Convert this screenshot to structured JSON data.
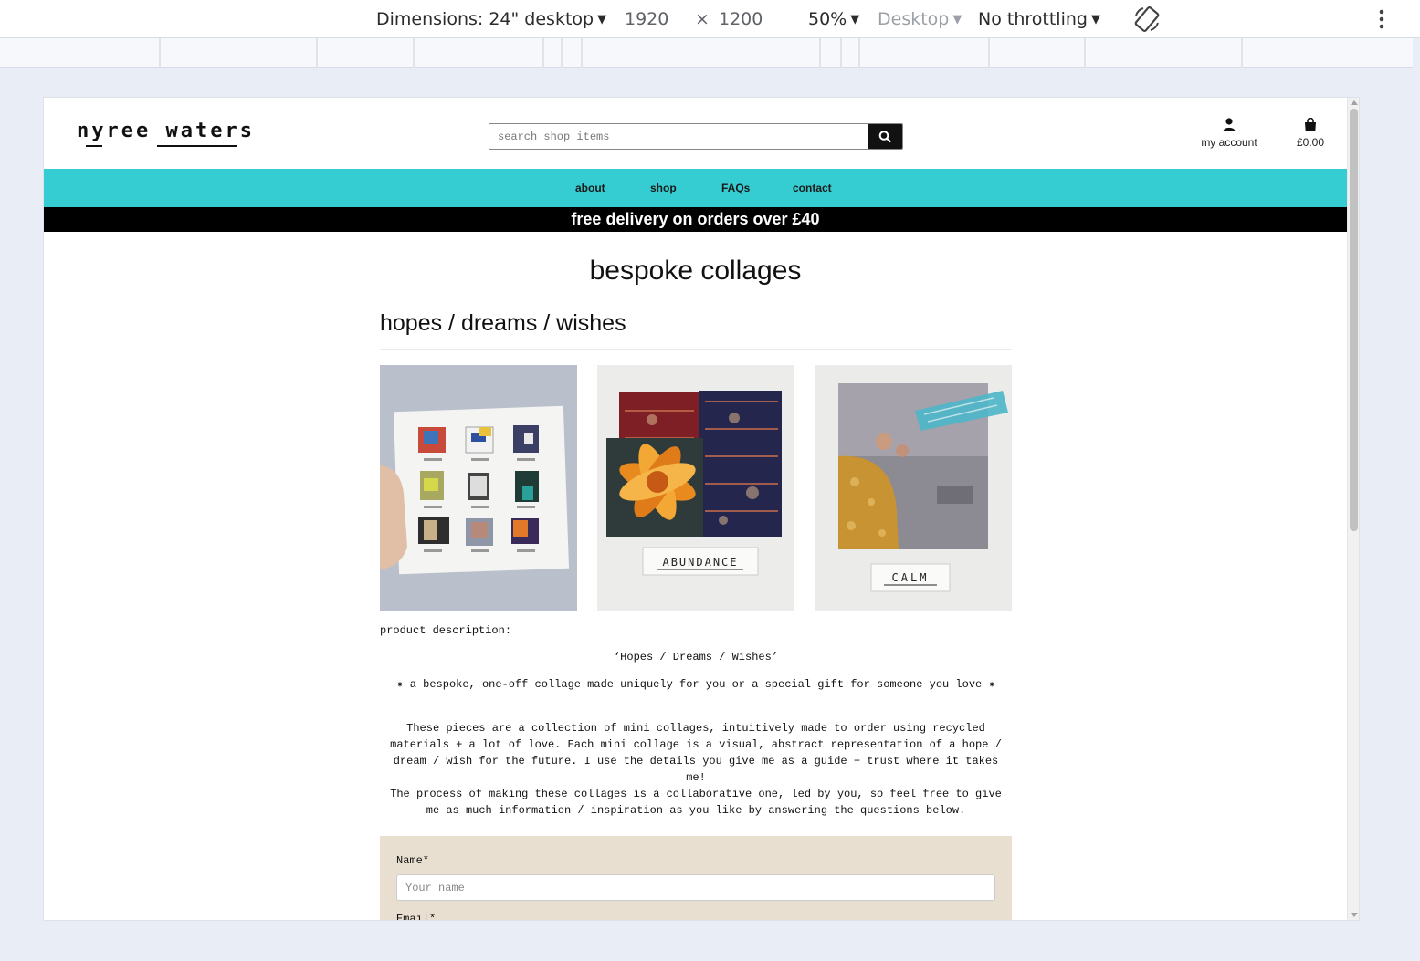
{
  "devtools": {
    "dimensions_label": "Dimensions: 24\" desktop",
    "width": "1920",
    "times": "×",
    "height": "1200",
    "zoom": "50%",
    "device_type": "Desktop",
    "throttling": "No throttling"
  },
  "site": {
    "logo_text": "nyree waters",
    "search_placeholder": "search shop items",
    "account_label": "my account",
    "cart_total": "£0.00",
    "nav": [
      "about",
      "shop",
      "FAQs",
      "contact"
    ],
    "promo": "free delivery on orders over £40",
    "brand_color": "#35cdd1"
  },
  "page": {
    "title": "bespoke collages",
    "product_title": "hopes / dreams / wishes",
    "images": [
      {
        "name": "mini-collage-grid"
      },
      {
        "name": "abundance-collage",
        "label": "ABUNDANCE"
      },
      {
        "name": "calm-collage",
        "label": "CALM"
      }
    ],
    "description_label": "product description:",
    "quote_title": "‘Hopes / Dreams / Wishes’",
    "tagline": "✷ a bespoke, one-off collage made uniquely for you or a special gift for someone you love ✷",
    "paragraph_lines": [
      "These pieces are a collection of mini collages, intuitively made to order using recycled",
      "materials + a lot of love. Each mini collage is a visual, abstract representation of a hope /",
      "dream / wish for the future. I use the details you give me as a guide + trust where it takes",
      "me!",
      "The process of making these collages is a collaborative one, led by you, so feel free to give",
      "me as much information / inspiration as you like by answering the questions below."
    ],
    "form": {
      "name_label": "Name*",
      "name_placeholder": "Your name",
      "email_label": "Email*"
    }
  }
}
